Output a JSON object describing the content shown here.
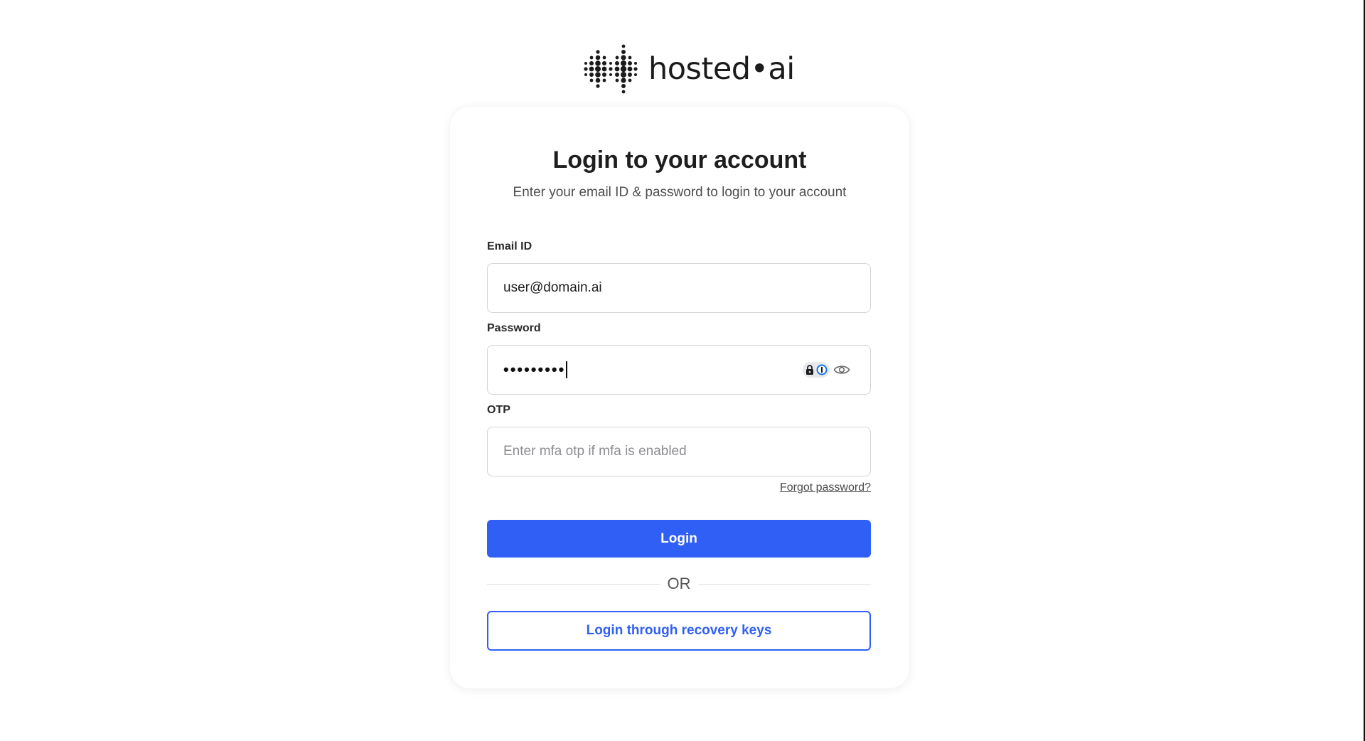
{
  "brand": {
    "logo_text": "hosted•ai",
    "logo_icon": "dotted-hash-logo"
  },
  "login": {
    "title": "Login to your account",
    "subtitle": "Enter your email ID & password to login to your account",
    "email": {
      "label": "Email ID",
      "value": "user@domain.ai"
    },
    "password": {
      "label": "Password",
      "masked_value": "•••••••••",
      "icons": [
        "lock-icon",
        "password-manager-icon",
        "eye-icon"
      ]
    },
    "otp": {
      "label": "OTP",
      "value": "",
      "placeholder": "Enter mfa otp if mfa is enabled"
    },
    "forgot_password": "Forgot password?",
    "login_button": "Login",
    "divider_text": "OR",
    "recovery_button": "Login through recovery keys"
  },
  "colors": {
    "accent": "#2f5ff5",
    "text": "#1e1e1e",
    "muted": "#4d4d4d",
    "border": "#d4d4d8"
  }
}
